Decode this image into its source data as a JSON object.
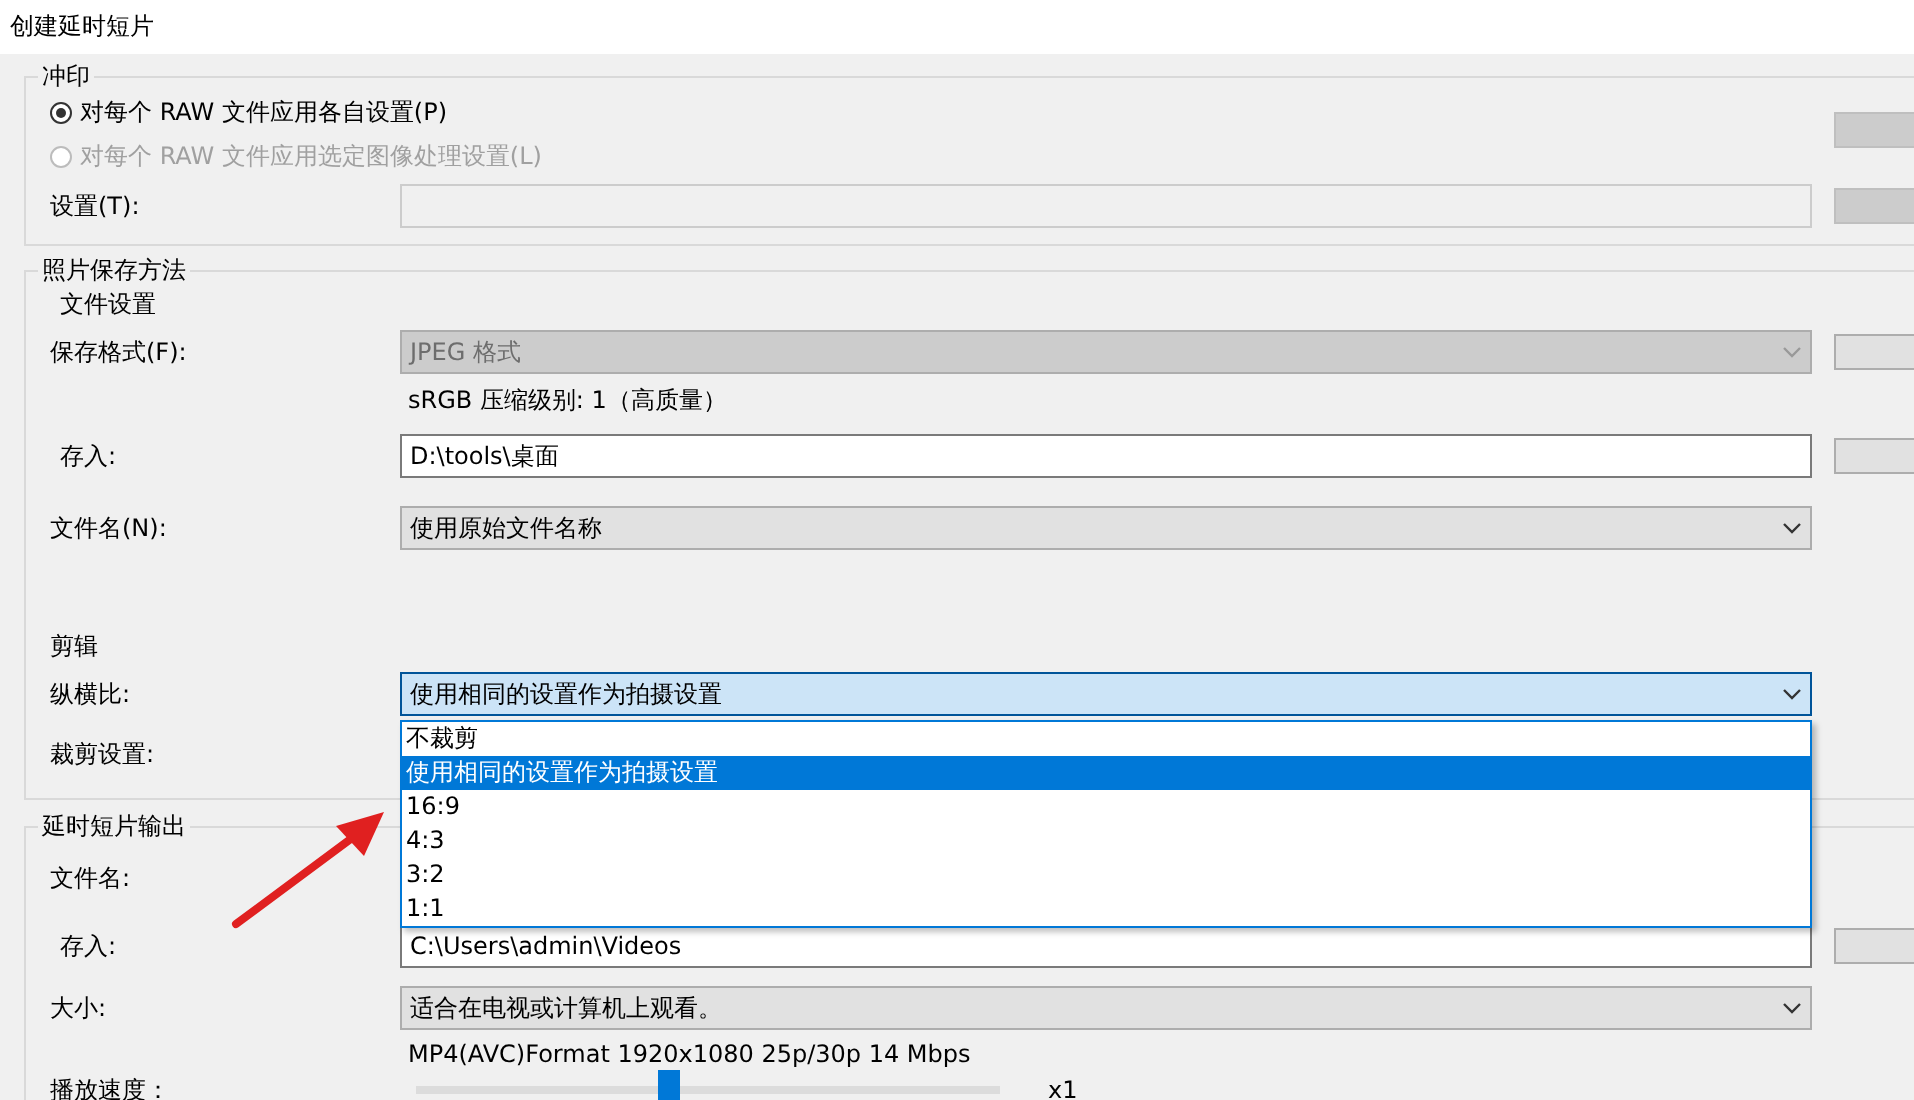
{
  "window": {
    "title": "创建延时短片"
  },
  "development": {
    "legend": "冲印",
    "options": [
      {
        "label": "对每个 RAW 文件应用各自设置(P)",
        "selected": true,
        "disabled": false
      },
      {
        "label": "对每个 RAW 文件应用选定图像处理设置(L)",
        "selected": false,
        "disabled": true
      }
    ],
    "settings": {
      "label": "设置(T):",
      "disabled": true
    }
  },
  "save": {
    "legend": "照片保存方法",
    "subheading": "文件设置",
    "format": {
      "label": "保存格式(F):",
      "value": "JPEG 格式",
      "disabled": true
    },
    "format_note": "sRGB 压缩级别: 1（高质量）",
    "save_to": {
      "label": "存入:",
      "value": "D:\\tools\\桌面"
    },
    "file_name": {
      "label": "文件名(N):",
      "value": "使用原始文件名称"
    },
    "crop_heading": "剪辑",
    "aspect": {
      "label": "纵横比:",
      "value": "使用相同的设置作为拍摄设置",
      "expanded": true,
      "options": [
        {
          "label": "不裁剪",
          "selected": false
        },
        {
          "label": "使用相同的设置作为拍摄设置",
          "selected": true
        },
        {
          "label": "16:9",
          "selected": false
        },
        {
          "label": "4:3",
          "selected": false
        },
        {
          "label": "3:2",
          "selected": false
        },
        {
          "label": "1:1",
          "selected": false
        }
      ]
    },
    "crop_settings": {
      "label": "裁剪设置:"
    }
  },
  "output": {
    "legend": "延时短片输出",
    "file_name": {
      "label": "文件名:"
    },
    "save_to": {
      "label": "存入:",
      "value": "C:\\Users\\admin\\Videos"
    },
    "size": {
      "label": "大小:",
      "value": "适合在电视或计算机上观看。"
    },
    "format_note": "MP4(AVC)Format 1920x1080 25p/30p 14 Mbps",
    "speed": {
      "label": "播放速度：",
      "level": 0.43,
      "reading": "x1"
    }
  }
}
